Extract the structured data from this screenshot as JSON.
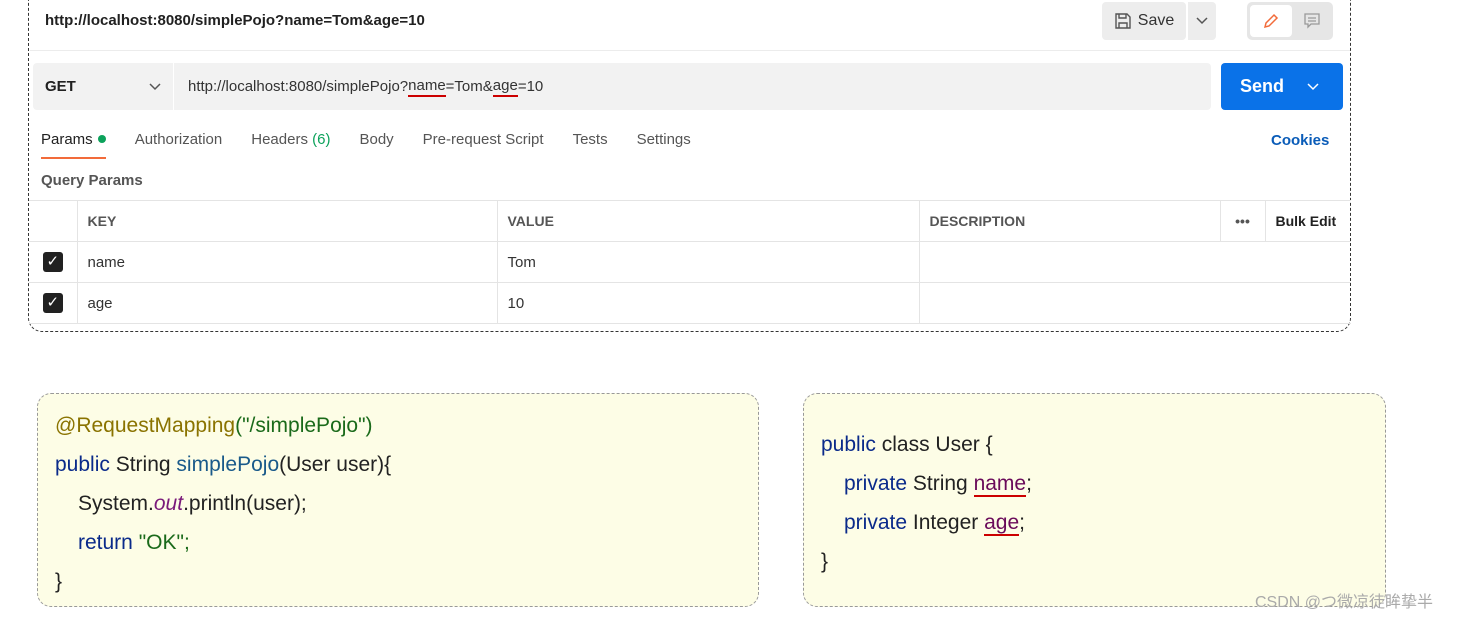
{
  "request": {
    "title": "http://localhost:8080/simplePojo?name=Tom&age=10",
    "save_label": "Save",
    "method": "GET",
    "url_parts": [
      "http://localhost:8080/simplePojo?",
      "name",
      "=Tom&",
      "age",
      "=10"
    ],
    "send_label": "Send"
  },
  "tabs": [
    {
      "label": "Params"
    },
    {
      "label": "Authorization"
    },
    {
      "label": "Headers",
      "count": "(6)"
    },
    {
      "label": "Body"
    },
    {
      "label": "Pre-request Script"
    },
    {
      "label": "Tests"
    },
    {
      "label": "Settings"
    }
  ],
  "cookies_label": "Cookies",
  "query_params_label": "Query Params",
  "table": {
    "headers": [
      "KEY",
      "VALUE",
      "DESCRIPTION"
    ],
    "more": "•••",
    "bulk_edit": "Bulk Edit",
    "rows": [
      {
        "key": "name",
        "value": "Tom",
        "description": "",
        "checked": true
      },
      {
        "key": "age",
        "value": "10",
        "description": "",
        "checked": true
      }
    ]
  },
  "code_left": [
    "@RequestMapping",
    "(\"/simplePojo\")",
    "public",
    " String ",
    "simplePojo",
    "(User user){",
    "System.",
    "out",
    ".println(user);",
    "return",
    " \"OK\";",
    "}"
  ],
  "code_right": [
    "public",
    "class User {",
    "private",
    " String ",
    "name",
    ";",
    "private",
    " Integer ",
    "age",
    ";",
    "}"
  ],
  "watermark": "CSDN @つ微凉徒眸挚半",
  "colors": {
    "accent": "#0a72e8",
    "active_tab": "#f26b3a",
    "code_bg": "#fdfde6"
  }
}
